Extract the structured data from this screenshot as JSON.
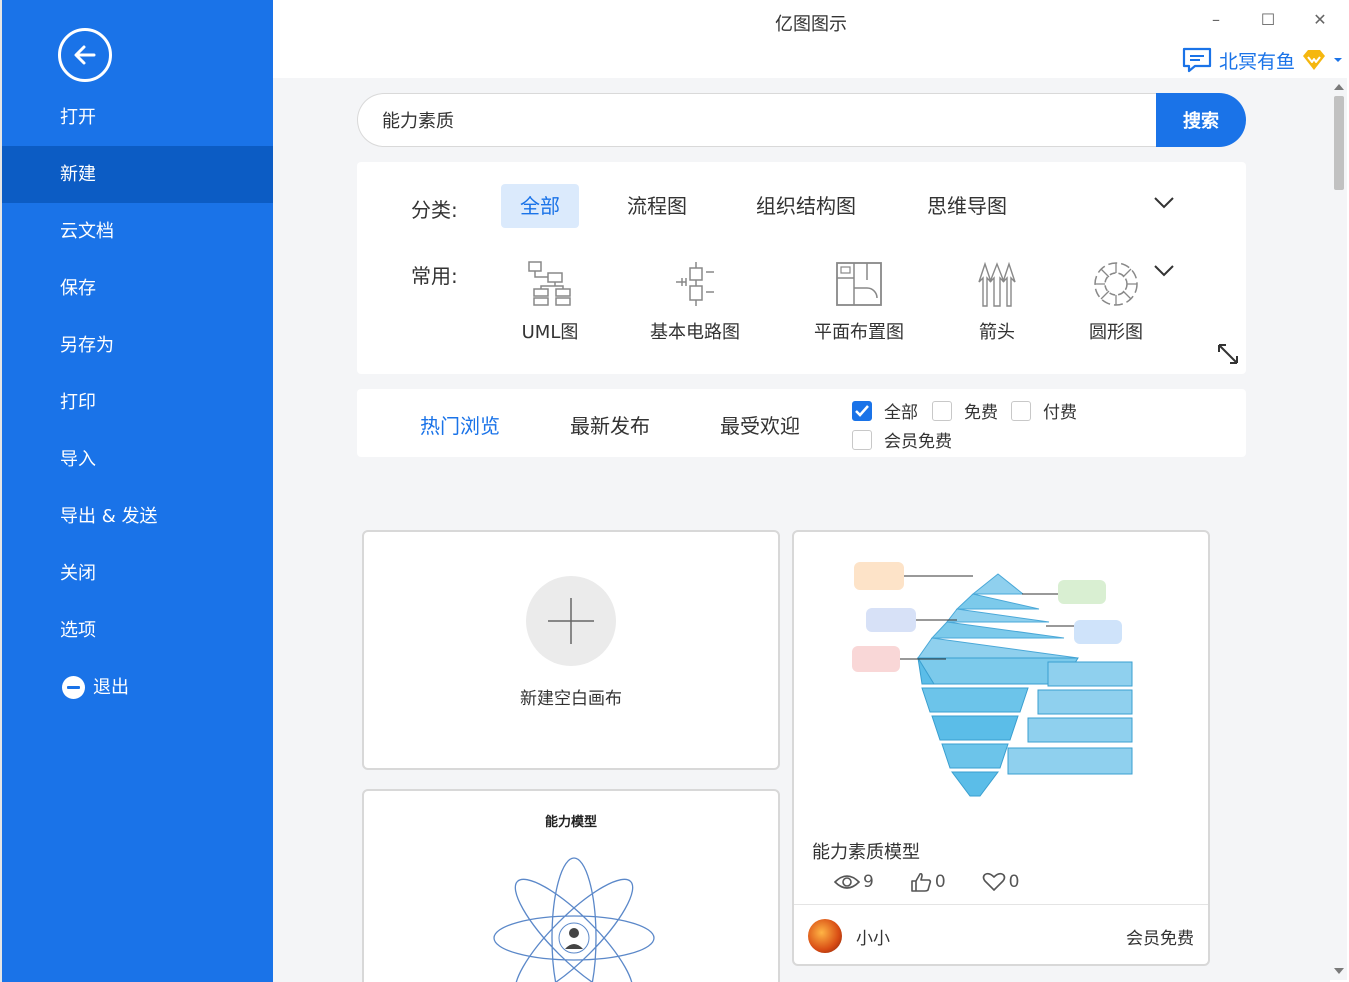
{
  "app": {
    "title": "亿图图示"
  },
  "window": {
    "minimize": "–",
    "maximize": "☐",
    "close": "✕"
  },
  "user": {
    "name": "北冥有鱼"
  },
  "sidebar": {
    "items": [
      {
        "label": "打开"
      },
      {
        "label": "新建",
        "active": true
      },
      {
        "label": "云文档"
      },
      {
        "label": "保存"
      },
      {
        "label": "另存为"
      },
      {
        "label": "打印"
      },
      {
        "label": "导入"
      },
      {
        "label": "导出 & 发送"
      },
      {
        "label": "关闭"
      },
      {
        "label": "选项"
      },
      {
        "label": "退出"
      }
    ]
  },
  "search": {
    "value": "能力素质",
    "button": "搜索"
  },
  "categories": {
    "label": "分类:",
    "tabs": [
      "全部",
      "流程图",
      "组织结构图",
      "思维导图"
    ],
    "active_tab": "全部"
  },
  "common": {
    "label": "常用:",
    "items": [
      {
        "label": "UML图",
        "icon": "uml-icon"
      },
      {
        "label": "基本电路图",
        "icon": "circuit-icon"
      },
      {
        "label": "平面布置图",
        "icon": "floorplan-icon"
      },
      {
        "label": "箭头",
        "icon": "arrow-shape-icon"
      },
      {
        "label": "圆形图",
        "icon": "circle-diagram-icon"
      }
    ]
  },
  "sort": {
    "tabs": [
      "热门浏览",
      "最新发布",
      "最受欢迎"
    ],
    "active_tab": "热门浏览"
  },
  "filters": [
    {
      "label": "全部",
      "checked": true
    },
    {
      "label": "免费",
      "checked": false
    },
    {
      "label": "付费",
      "checked": false
    },
    {
      "label": "会员免费",
      "checked": false
    }
  ],
  "blank_card": {
    "label": "新建空白画布"
  },
  "template_card": {
    "title": "能力素质模型",
    "views": "9",
    "likes": "0",
    "favorites": "0",
    "author": "小小",
    "price": "会员免费"
  },
  "model_card": {
    "title": "能力模型"
  },
  "colors": {
    "accent": "#1a73e8",
    "sidebar": "#1a73e8",
    "sidebar_active": "#0c5cc4",
    "gold": "#f5b70f"
  }
}
